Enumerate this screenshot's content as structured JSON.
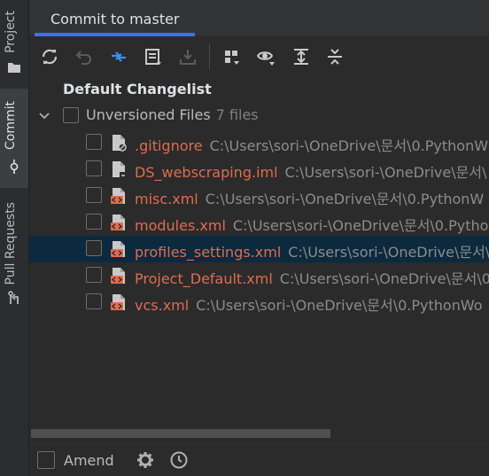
{
  "sidebar": {
    "project_label": "Project",
    "commit_label": "Commit",
    "pull_requests_label": "Pull Requests"
  },
  "header": {
    "tab_label": "Commit to master"
  },
  "toolbar": {
    "buttons": [
      "refresh-icon",
      "rollback-icon",
      "show-diff-icon",
      "commit-message-icon",
      "shelve-icon",
      "group-by-icon",
      "view-options-icon",
      "expand-all-icon",
      "collapse-all-icon"
    ]
  },
  "tree": {
    "changelist_title": "Default Changelist",
    "group": {
      "label": "Unversioned Files",
      "count": "7 files"
    },
    "files": [
      {
        "name": ".gitignore",
        "path": "C:\\Users\\sori-\\OneDrive\\문서\\0.PythonW"
      },
      {
        "name": "DS_webscraping.iml",
        "path": "C:\\Users\\sori-\\OneDrive\\문서\\"
      },
      {
        "name": "misc.xml",
        "path": "C:\\Users\\sori-\\OneDrive\\문서\\0.PythonW"
      },
      {
        "name": "modules.xml",
        "path": "C:\\Users\\sori-\\OneDrive\\문서\\0.Pytho"
      },
      {
        "name": "profiles_settings.xml",
        "path": "C:\\Users\\sori-\\OneDrive\\문서\\"
      },
      {
        "name": "Project_Default.xml",
        "path": "C:\\Users\\sori-\\OneDrive\\문서\\0"
      },
      {
        "name": "vcs.xml",
        "path": "C:\\Users\\sori-\\OneDrive\\문서\\0.PythonWo"
      }
    ],
    "selected_index": 4
  },
  "footer": {
    "amend_label": "Amend"
  },
  "colors": {
    "accent": "#3574f0",
    "unversioned": "#e06c4f",
    "selection": "#0d293e"
  }
}
